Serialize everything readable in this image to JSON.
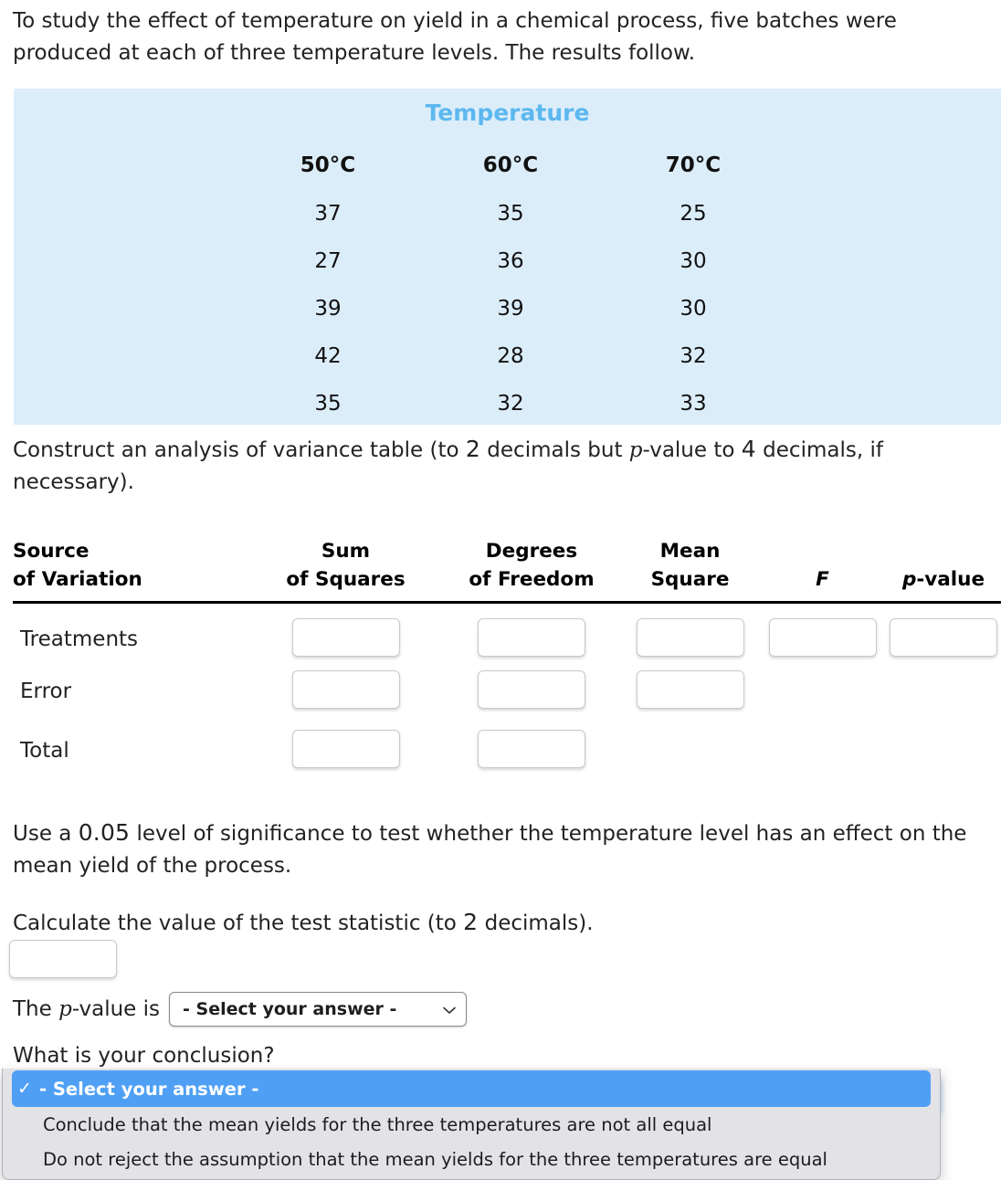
{
  "intro": {
    "line1": "To study the effect of temperature on yield in a chemical process, five batches were",
    "line2": "produced at each of three temperature levels. The results follow."
  },
  "data_table": {
    "title": "Temperature",
    "columns": [
      "50°C",
      "60°C",
      "70°C"
    ],
    "rows": [
      [
        "37",
        "35",
        "25"
      ],
      [
        "27",
        "36",
        "30"
      ],
      [
        "39",
        "39",
        "30"
      ],
      [
        "42",
        "28",
        "32"
      ],
      [
        "35",
        "32",
        "33"
      ]
    ],
    "background": "#dcedfa",
    "title_color": "#5cb8ef"
  },
  "construct": {
    "part1": "Construct an analysis of variance table (to ",
    "n1": "2",
    "part2": " decimals but ",
    "p": "p",
    "part3": "-value to ",
    "n2": "4",
    "part4": " decimals, if",
    "line2": "necessary)."
  },
  "anova": {
    "headers": [
      {
        "l1": "Source",
        "l2": "of Variation"
      },
      {
        "l1": "Sum",
        "l2": "of Squares"
      },
      {
        "l1": "Degrees",
        "l2": "of Freedom"
      },
      {
        "l1": "Mean",
        "l2": "Square"
      },
      {
        "l1": "",
        "l2": "F"
      },
      {
        "l1": "",
        "l2": "p-value"
      }
    ],
    "rows": [
      {
        "label": "Treatments",
        "inputs": 5,
        "values": [
          "",
          "",
          "",
          "",
          ""
        ]
      },
      {
        "label": "Error",
        "inputs": 3,
        "values": [
          "",
          "",
          ""
        ]
      },
      {
        "label": "Total",
        "inputs": 2,
        "values": [
          "",
          ""
        ]
      }
    ]
  },
  "significance": {
    "part1": "Use a ",
    "alpha": "0.05",
    "part2": " level of significance to test whether the temperature level has an effect on the",
    "line2": "mean yield of the process."
  },
  "calculate": {
    "part1": "Calculate the value of the test statistic (to ",
    "n": "2",
    "part2": " decimals).",
    "input_value": ""
  },
  "pvalue": {
    "prefix_a": "The ",
    "prefix_p": "p",
    "prefix_b": "-value is",
    "select_value": "- Select your answer -",
    "chevron": "chevron-down-icon"
  },
  "conclusion": {
    "question": "What is your conclusion?",
    "select_value": "- Select your answer -",
    "options": [
      {
        "label": "- Select your answer -",
        "selected": true,
        "check": "✓"
      },
      {
        "label": "Conclude that the mean yields for the three temperatures are not all equal",
        "selected": false,
        "check": ""
      },
      {
        "label": "Do not reject the assumption that the mean yields for the three temperatures are equal",
        "selected": false,
        "check": ""
      }
    ],
    "highlight_color": "#4fa0f5",
    "panel_background": "#e3e2e6"
  }
}
